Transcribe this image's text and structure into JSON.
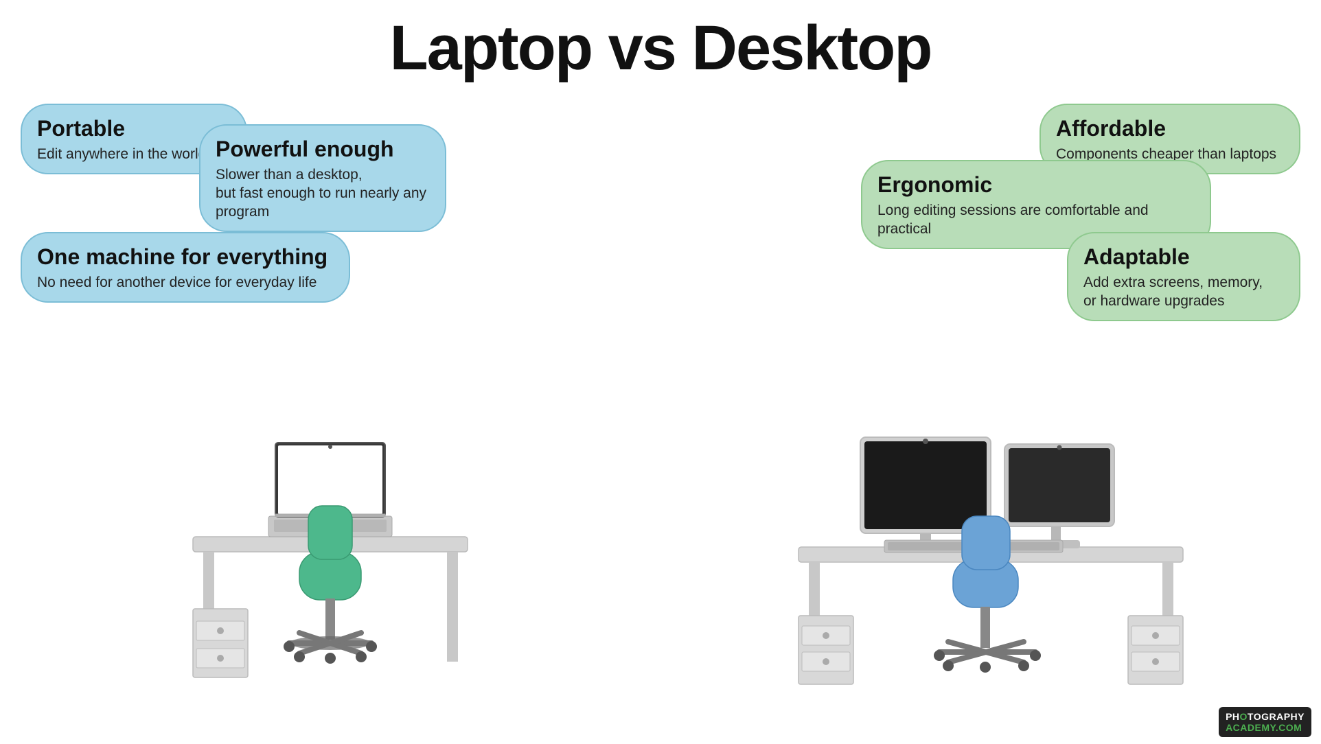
{
  "title": "Laptop vs Desktop",
  "left": {
    "bubble_portable_title": "Portable",
    "bubble_portable_sub": "Edit anywhere in the world",
    "bubble_powerful_title": "Powerful enough",
    "bubble_powerful_sub": "Slower than a desktop,\nbut fast enough to run nearly any program",
    "bubble_one_machine_title": "One machine for everything",
    "bubble_one_machine_sub": "No need for another device for everyday life"
  },
  "right": {
    "bubble_affordable_title": "Affordable",
    "bubble_affordable_sub": "Components cheaper than laptops",
    "bubble_ergonomic_title": "Ergonomic",
    "bubble_ergonomic_sub": "Long editing sessions are comfortable and practical",
    "bubble_adaptable_title": "Adaptable",
    "bubble_adaptable_sub": "Add extra screens, memory,\nor hardware upgrades"
  },
  "watermark": "PHOTOGRAPHY ACADEMY.COM"
}
